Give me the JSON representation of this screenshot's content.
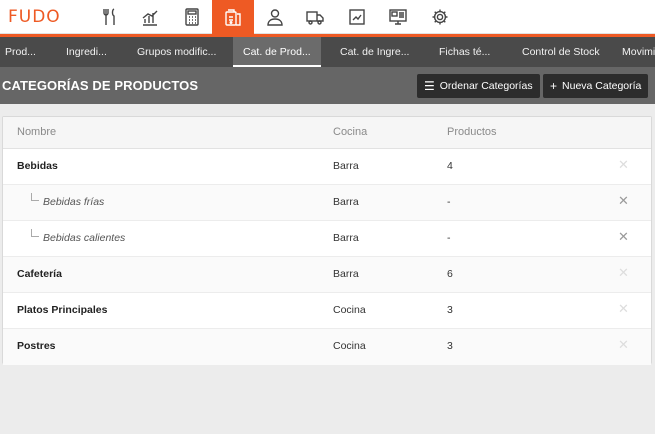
{
  "brand": {
    "logo_text": "FUDO",
    "accent": "#ee5a24"
  },
  "nav": {
    "icons": [
      {
        "name": "utensils-icon"
      },
      {
        "name": "bar-chart-icon"
      },
      {
        "name": "calculator-icon"
      },
      {
        "name": "products-icon",
        "active": true
      },
      {
        "name": "user-icon"
      },
      {
        "name": "truck-icon"
      },
      {
        "name": "report-icon"
      },
      {
        "name": "monitor-icon"
      },
      {
        "name": "gear-icon"
      }
    ]
  },
  "tabs": [
    {
      "label": "Prod..."
    },
    {
      "label": "Ingredi..."
    },
    {
      "label": "Grupos modific..."
    },
    {
      "label": "Cat. de Prod...",
      "active": true
    },
    {
      "label": "Cat. de Ingre..."
    },
    {
      "label": "Fichas té..."
    },
    {
      "label": "Control de Stock"
    },
    {
      "label": "Movimi"
    }
  ],
  "page": {
    "title": "CATEGORÍAS DE PRODUCTOS",
    "order_button": "Ordenar Categorías",
    "new_button": "Nueva Categoría"
  },
  "table": {
    "headers": {
      "name": "Nombre",
      "kitchen": "Cocina",
      "products": "Productos"
    },
    "rows": [
      {
        "name": "Bebidas",
        "kitchen": "Barra",
        "products": "4",
        "sub": false
      },
      {
        "name": "Bebidas frías",
        "kitchen": "Barra",
        "products": "-",
        "sub": true
      },
      {
        "name": "Bebidas calientes",
        "kitchen": "Barra",
        "products": "-",
        "sub": true
      },
      {
        "name": "Cafetería",
        "kitchen": "Barra",
        "products": "6",
        "sub": false
      },
      {
        "name": "Platos Principales",
        "kitchen": "Cocina",
        "products": "3",
        "sub": false
      },
      {
        "name": "Postres",
        "kitchen": "Cocina",
        "products": "3",
        "sub": false
      }
    ]
  }
}
